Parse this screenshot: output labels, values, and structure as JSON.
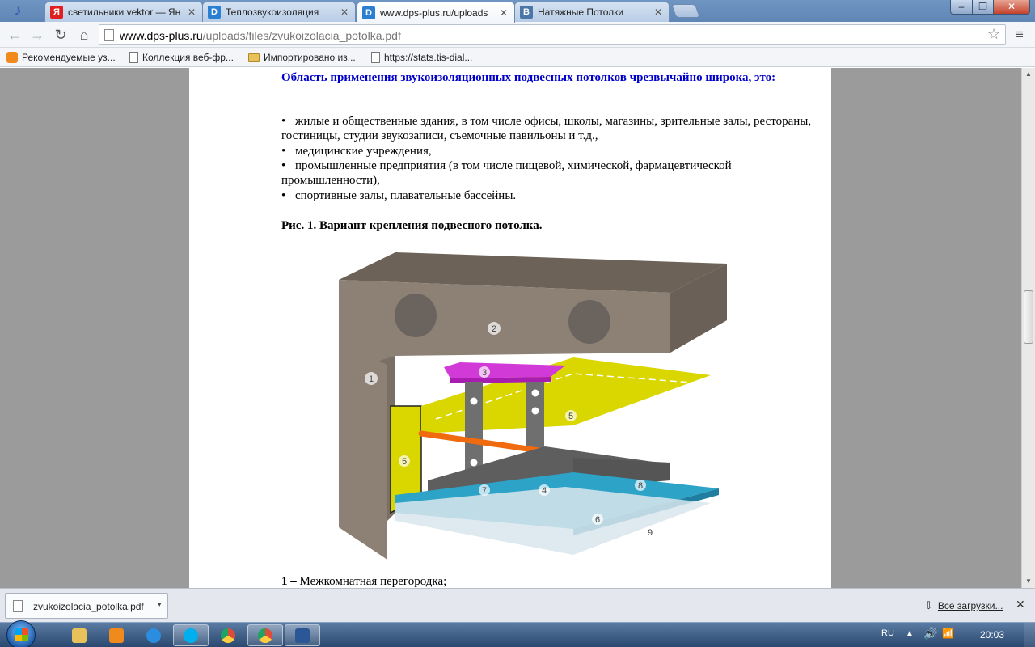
{
  "tabs": [
    {
      "favicon": "yandex-icon",
      "favicon_text": "Я",
      "favicon_color": "#e02020",
      "title": "светильники vektor — Ян"
    },
    {
      "favicon": "dps-icon",
      "favicon_text": "D",
      "favicon_color": "#2a7fd0",
      "title": "Теплозвукоизоляция"
    },
    {
      "favicon": "dps-icon",
      "favicon_text": "D",
      "favicon_color": "#2a7fd0",
      "title": "www.dps-plus.ru/uploads"
    },
    {
      "favicon": "vk-icon",
      "favicon_text": "В",
      "favicon_color": "#4a76a8",
      "title": "Натяжные Потолки"
    }
  ],
  "active_tab": 2,
  "window_controls": {
    "minimize": "‒",
    "maximize": "❐",
    "close": "✕"
  },
  "url": {
    "host": "www.dps-plus.ru",
    "path": "/uploads/files/zvukoizolacia_potolka.pdf"
  },
  "bookmarks": [
    {
      "icon": "bulb-icon",
      "label": "Рекомендуемые уз..."
    },
    {
      "icon": "page-icon",
      "label": "Коллекция веб-фр..."
    },
    {
      "icon": "folder-icon",
      "label": "Импортировано из..."
    },
    {
      "icon": "page-icon",
      "label": "https://stats.tis-dial..."
    }
  ],
  "document": {
    "heading": "Область применения звукоизоляционных подвесных потолков чрезвычайно широка, это:",
    "bullet": "•",
    "items": [
      "жилые и общественные здания, в том числе офисы, школы, магазины, зрительные залы, рестораны, гостиницы, студии звукозаписи, съемочные павильоны и т.д.,",
      "медицинские учреждения,",
      "промышленные предприятия (в том числе пищевой, химической, фармацевтической промышленности),",
      "спортивные залы, плавательные бассейны."
    ],
    "figure_caption": "Рис. 1. Вариант крепления подвесного потолка.",
    "figure_labels": [
      "1",
      "2",
      "3",
      "4",
      "5",
      "5",
      "6",
      "7",
      "8",
      "9"
    ],
    "legend_number": "1 –",
    "legend_text": "Межкомнатная перегородка;"
  },
  "download": {
    "filename": "zvukoizolacia_potolka.pdf",
    "show_all": "Все загрузки..."
  },
  "taskbar": {
    "apps": [
      {
        "name": "explorer-icon",
        "color": "#e8c15a"
      },
      {
        "name": "media-player-icon",
        "color": "#f08a1c"
      },
      {
        "name": "ie-icon",
        "color": "#2a8de0"
      },
      {
        "name": "skype-icon",
        "color": "#00aff0"
      },
      {
        "name": "chrome-icon",
        "color": "#dd4b39"
      },
      {
        "name": "chrome-active-icon",
        "color": "#dd4b39"
      },
      {
        "name": "word-icon",
        "color": "#2b5797"
      }
    ],
    "language": "RU",
    "clock": "20:03"
  },
  "colors": {
    "heading": "#0000cc",
    "slab": "#8a7d6f",
    "metal": "#6f6f6f",
    "yellow": "#d9d600",
    "magenta": "#d23ad8",
    "blue": "#2ea3c8",
    "orange": "#f06a10"
  }
}
